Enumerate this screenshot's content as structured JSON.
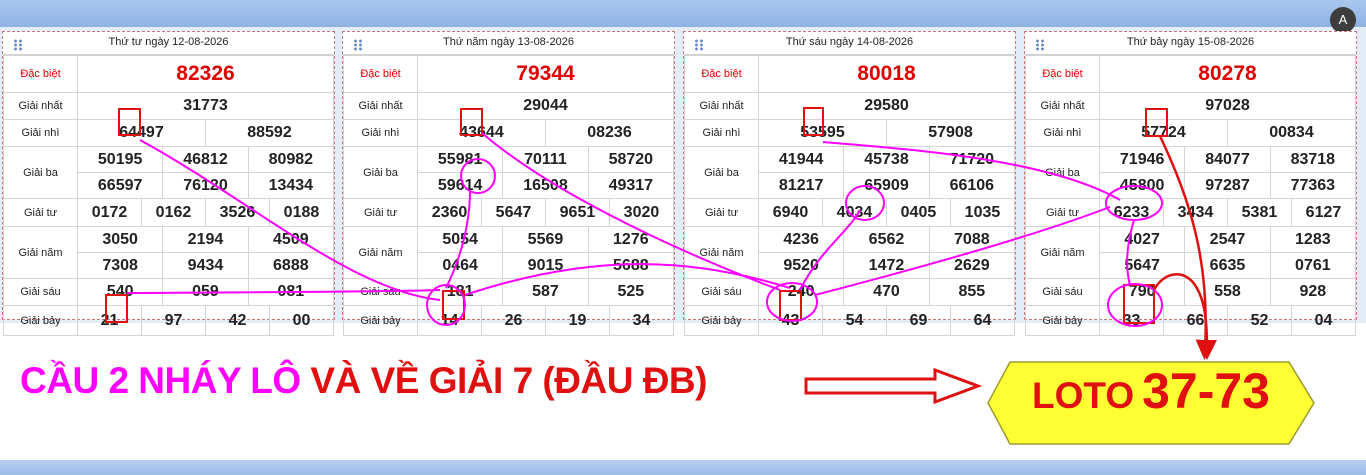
{
  "panels": [
    {
      "date": "Thứ tư ngày 12-08-2026",
      "rows": [
        {
          "label": "Đặc biệt",
          "numbers": [
            "82326"
          ]
        },
        {
          "label": "Giải nhất",
          "numbers": [
            "31773"
          ]
        },
        {
          "label": "Giải nhì",
          "numbers": [
            "64497",
            "88592"
          ]
        },
        {
          "label": "Giải ba",
          "numbers": [
            "50195",
            "46812",
            "80982",
            "66597",
            "76120",
            "13434"
          ]
        },
        {
          "label": "Giải tư",
          "numbers": [
            "0172",
            "0162",
            "3526",
            "0188"
          ]
        },
        {
          "label": "Giải năm",
          "numbers": [
            "3050",
            "2194",
            "4509",
            "7308",
            "9434",
            "6888"
          ]
        },
        {
          "label": "Giải sáu",
          "numbers": [
            "540",
            "059",
            "081"
          ]
        },
        {
          "label": "Giải bảy",
          "numbers": [
            "21",
            "97",
            "42",
            "00"
          ]
        }
      ]
    },
    {
      "date": "Thứ năm ngày 13-08-2026",
      "rows": [
        {
          "label": "Đặc biệt",
          "numbers": [
            "79344"
          ]
        },
        {
          "label": "Giải nhất",
          "numbers": [
            "29044"
          ]
        },
        {
          "label": "Giải nhì",
          "numbers": [
            "43644",
            "08236"
          ]
        },
        {
          "label": "Giải ba",
          "numbers": [
            "55981",
            "70111",
            "58720",
            "59614",
            "16508",
            "49317"
          ]
        },
        {
          "label": "Giải tư",
          "numbers": [
            "2360",
            "5647",
            "9651",
            "3020"
          ]
        },
        {
          "label": "Giải năm",
          "numbers": [
            "5054",
            "5569",
            "1276",
            "0464",
            "9015",
            "5688"
          ]
        },
        {
          "label": "Giải sáu",
          "numbers": [
            "181",
            "587",
            "525"
          ]
        },
        {
          "label": "Giải bảy",
          "numbers": [
            "14",
            "26",
            "19",
            "34"
          ]
        }
      ]
    },
    {
      "date": "Thứ sáu ngày 14-08-2026",
      "rows": [
        {
          "label": "Đặc biệt",
          "numbers": [
            "80018"
          ]
        },
        {
          "label": "Giải nhất",
          "numbers": [
            "29580"
          ]
        },
        {
          "label": "Giải nhì",
          "numbers": [
            "53595",
            "57908"
          ]
        },
        {
          "label": "Giải ba",
          "numbers": [
            "41944",
            "45738",
            "71720",
            "81217",
            "65909",
            "66106"
          ]
        },
        {
          "label": "Giải tư",
          "numbers": [
            "6940",
            "4034",
            "0405",
            "1035"
          ]
        },
        {
          "label": "Giải năm",
          "numbers": [
            "4236",
            "6562",
            "7088",
            "9520",
            "1472",
            "2629"
          ]
        },
        {
          "label": "Giải sáu",
          "numbers": [
            "240",
            "470",
            "855"
          ]
        },
        {
          "label": "Giải bảy",
          "numbers": [
            "43",
            "54",
            "69",
            "64"
          ]
        }
      ]
    },
    {
      "date": "Thứ bảy ngày 15-08-2026",
      "rows": [
        {
          "label": "Đặc biệt",
          "numbers": [
            "80278"
          ]
        },
        {
          "label": "Giải nhất",
          "numbers": [
            "97028"
          ]
        },
        {
          "label": "Giải nhì",
          "numbers": [
            "57724",
            "00834"
          ]
        },
        {
          "label": "Giải ba",
          "numbers": [
            "71946",
            "84077",
            "83718",
            "45800",
            "97287",
            "77363"
          ]
        },
        {
          "label": "Giải tư",
          "numbers": [
            "6233",
            "3434",
            "5381",
            "6127"
          ]
        },
        {
          "label": "Giải năm",
          "numbers": [
            "4027",
            "2547",
            "1283",
            "5647",
            "6635",
            "0761"
          ]
        },
        {
          "label": "Giải sáu",
          "numbers": [
            "790",
            "558",
            "928"
          ]
        },
        {
          "label": "Giải bảy",
          "numbers": [
            "33",
            "66",
            "52",
            "04"
          ]
        }
      ]
    }
  ],
  "caption": {
    "part1": "CẦU 2 NHÁY LÔ",
    "part2": "VÀ VỀ GIẢI 7 (ĐẦU ĐB)"
  },
  "result": {
    "prefix": "LOTO",
    "value": "37-73"
  },
  "corner_icon": "A",
  "colors": {
    "accent_magenta": "#ff00ff",
    "accent_red": "#e01010",
    "banner_yellow": "#ffff33"
  }
}
